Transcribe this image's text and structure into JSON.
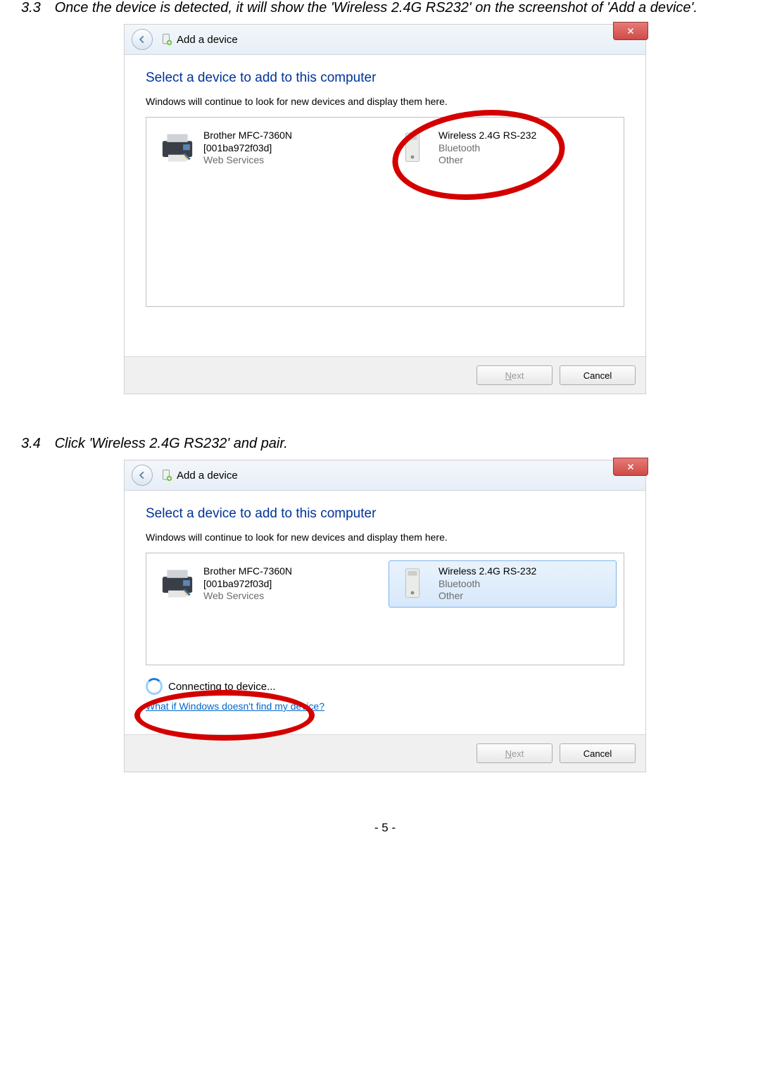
{
  "step1": {
    "num": "3.3",
    "text": "Once the device is detected, it will show the 'Wireless 2.4G RS232' on the screenshot of 'Add a device'."
  },
  "step2": {
    "num": "3.4",
    "text": "Click 'Wireless 2.4G RS232' and pair."
  },
  "window": {
    "title": "Add a device",
    "heading": "Select a device to add to this computer",
    "subtext": "Windows will continue to look for new devices and display them here.",
    "devices": [
      {
        "name": "Brother MFC-7360N",
        "line2": "[001ba972f03d]",
        "line3": "Web Services"
      },
      {
        "name": "Wireless 2.4G RS-232",
        "line2": "Bluetooth",
        "line3": "Other"
      }
    ],
    "status": "Connecting to device...",
    "help": "What if Windows doesn't find my device?",
    "next": "Next",
    "cancel": "Cancel"
  },
  "pageNumber": "5"
}
